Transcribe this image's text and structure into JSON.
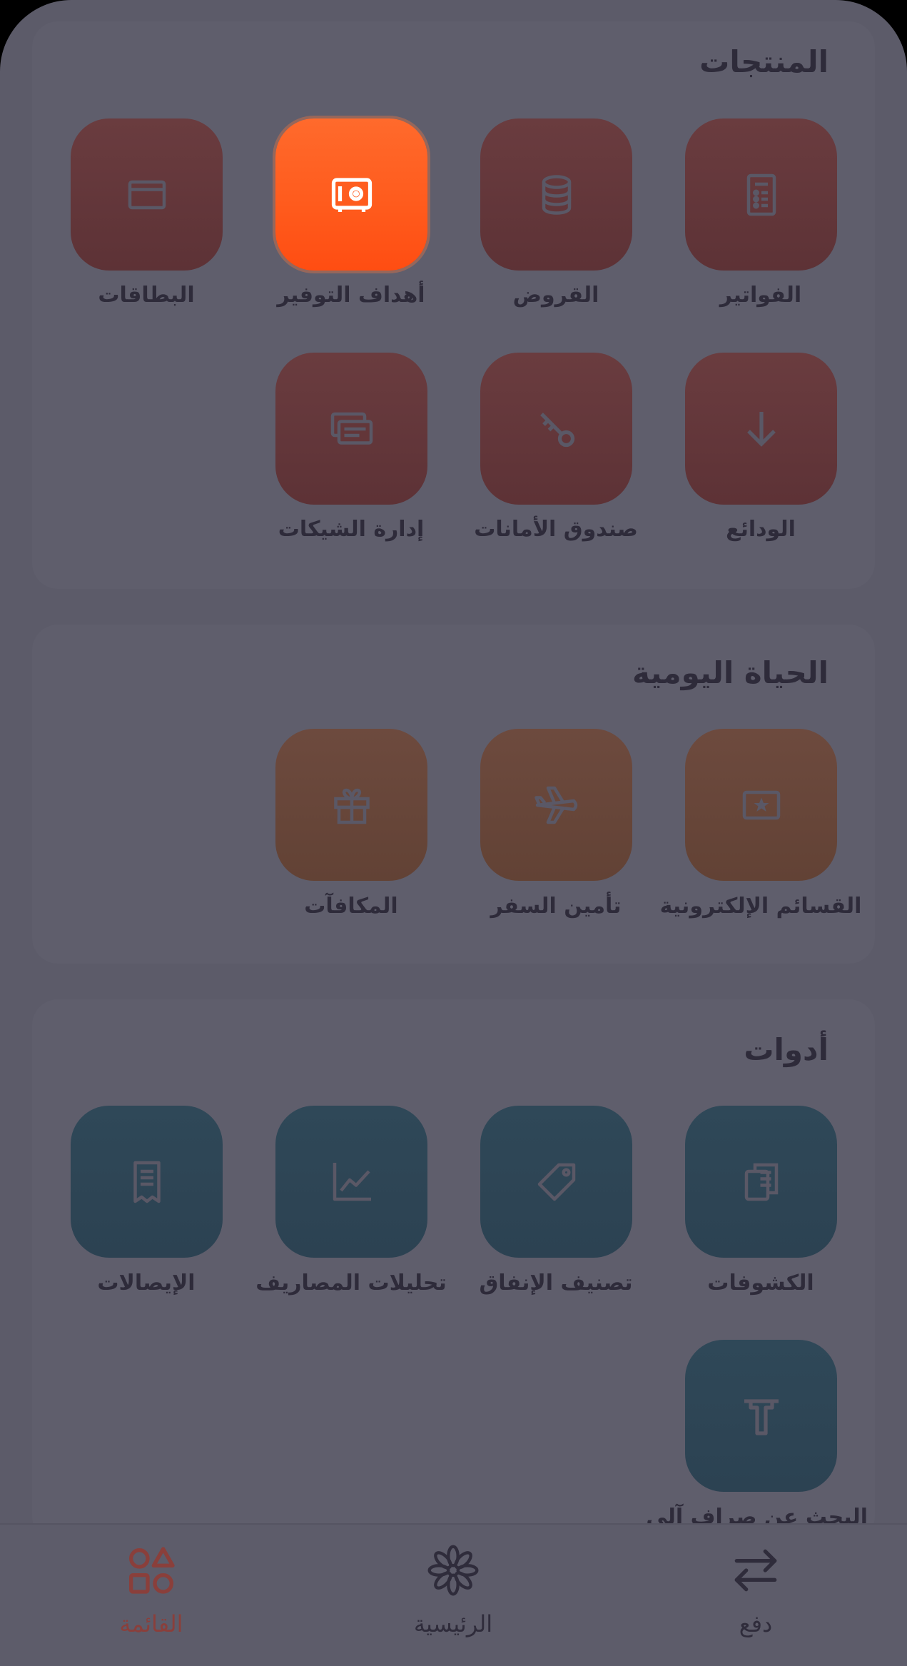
{
  "sections": {
    "products": {
      "title": "المنتجات",
      "items": [
        {
          "label": "الفواتير",
          "icon": "invoice-icon"
        },
        {
          "label": "القروض",
          "icon": "coins-stack-icon"
        },
        {
          "label": "أهداف التوفير",
          "icon": "safe-icon"
        },
        {
          "label": "البطاقات",
          "icon": "card-icon"
        },
        {
          "label": "الودائع",
          "icon": "arrow-down-icon"
        },
        {
          "label": "صندوق الأمانات",
          "icon": "key-icon"
        },
        {
          "label": "إدارة الشيكات",
          "icon": "cheques-icon"
        }
      ]
    },
    "daily_life": {
      "title": "الحياة اليومية",
      "items": [
        {
          "label": "القسائم الإلكترونية",
          "icon": "voucher-icon"
        },
        {
          "label": "تأمين السفر",
          "icon": "airplane-icon"
        },
        {
          "label": "المكافآت",
          "icon": "gift-icon"
        }
      ]
    },
    "tools": {
      "title": "أدوات",
      "items": [
        {
          "label": "الكشوفات",
          "icon": "statements-icon"
        },
        {
          "label": "تصنيف الإنفاق",
          "icon": "tag-icon"
        },
        {
          "label": "تحليلات المصاريف",
          "icon": "chart-line-icon"
        },
        {
          "label": "الإيصالات",
          "icon": "receipt-icon"
        },
        {
          "label": "البحث عن صراف آلي",
          "icon": "atm-icon"
        }
      ]
    }
  },
  "nav": {
    "pay": "دفع",
    "home": "الرئيسية",
    "menu": "القائمة"
  },
  "colors": {
    "active_tile": "#ff5a1c",
    "products_tile": "#633639",
    "daily_tile": "#684539",
    "tools_tile": "#2e4555",
    "active_nav": "#8a3f3b"
  }
}
